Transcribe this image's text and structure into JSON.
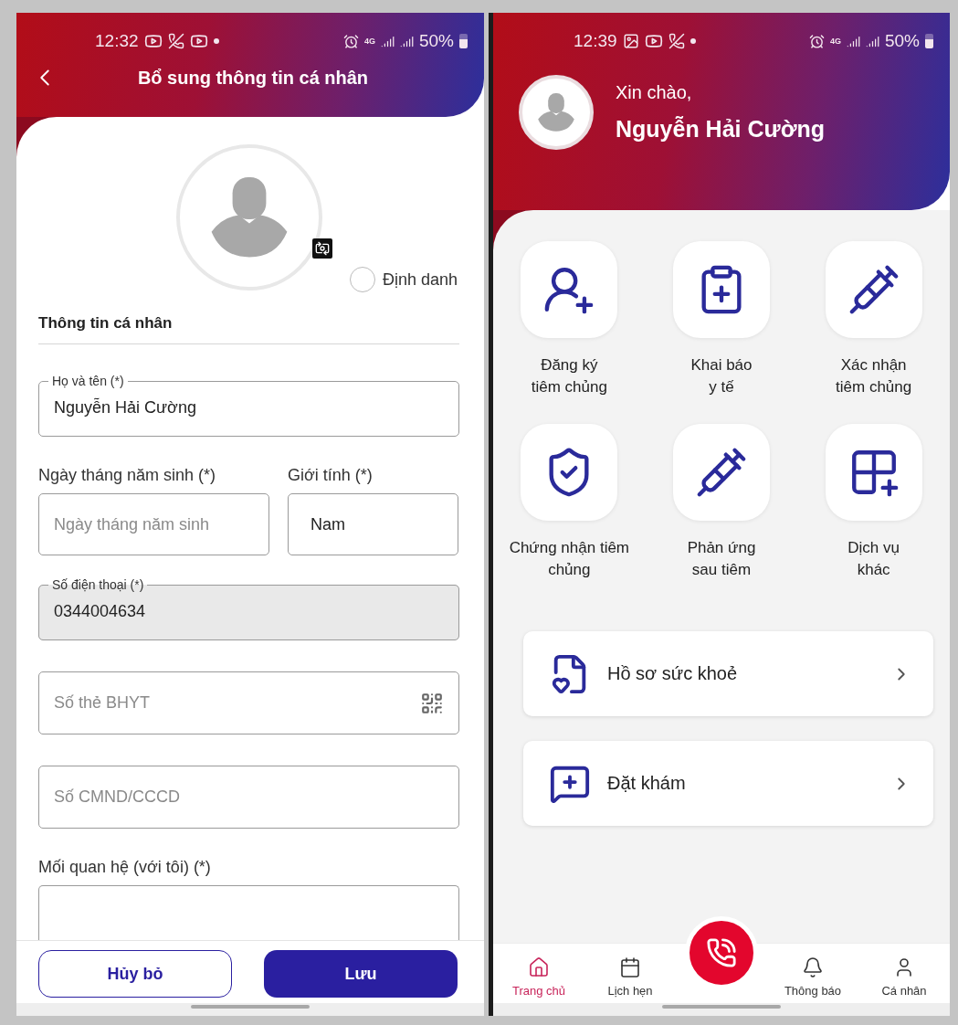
{
  "form_screen": {
    "status_bar": {
      "time": "12:32",
      "network": "4G",
      "battery": "50%"
    },
    "title": "Bổ sung thông tin cá nhân",
    "identify_option": {
      "label": "Định danh",
      "checked": false
    },
    "section_title": "Thông tin cá nhân",
    "fields": [
      {
        "kind": "floating",
        "label": "Họ và tên (*)",
        "value": "Nguyễn Hải Cường",
        "disabled": false
      },
      {
        "kind": "pair",
        "items": [
          {
            "label": "Ngày tháng năm sinh (*)",
            "placeholder": "Ngày tháng năm sinh"
          },
          {
            "label": "Giới tính (*)",
            "value": "Nam"
          }
        ]
      },
      {
        "kind": "floating",
        "label": "Số điện thoại (*)",
        "value": "0344004634",
        "disabled": true
      },
      {
        "kind": "plain",
        "placeholder": "Số thẻ BHYT",
        "scan": true
      },
      {
        "kind": "plain",
        "placeholder": "Số CMND/CCCD",
        "scan": false
      },
      {
        "kind": "cut",
        "label": "Mối quan hệ (với tôi) (*)"
      }
    ],
    "buttons": [
      {
        "label": "Hủy bỏ",
        "kind": "secondary"
      },
      {
        "label": "Lưu",
        "kind": "primary"
      }
    ]
  },
  "home_screen": {
    "status_bar": {
      "time": "12:39",
      "network": "4G",
      "battery": "50%"
    },
    "greeting": "Xin chào,",
    "user_name": "Nguyễn Hải Cường",
    "services": [
      {
        "label": "Đăng ký\ntiêm chủng"
      },
      {
        "label": "Khai báo\ny tế"
      },
      {
        "label": "Xác nhận\ntiêm chủng"
      },
      {
        "label": "Chứng nhận tiêm\nchủng"
      },
      {
        "label": "Phản ứng\nsau tiêm"
      },
      {
        "label": "Dịch vụ\nkhác"
      }
    ],
    "shortcuts": [
      {
        "label": "Hồ sơ sức khoẻ"
      },
      {
        "label": "Đặt khám"
      }
    ],
    "nav": [
      {
        "kind": "tab",
        "label": "Trang chủ",
        "selected": true
      },
      {
        "kind": "tab",
        "label": "Lịch hẹn",
        "selected": false
      },
      {
        "kind": "call"
      },
      {
        "kind": "tab",
        "label": "Thông báo",
        "selected": false
      },
      {
        "kind": "tab",
        "label": "Cá nhân",
        "selected": false
      }
    ]
  }
}
